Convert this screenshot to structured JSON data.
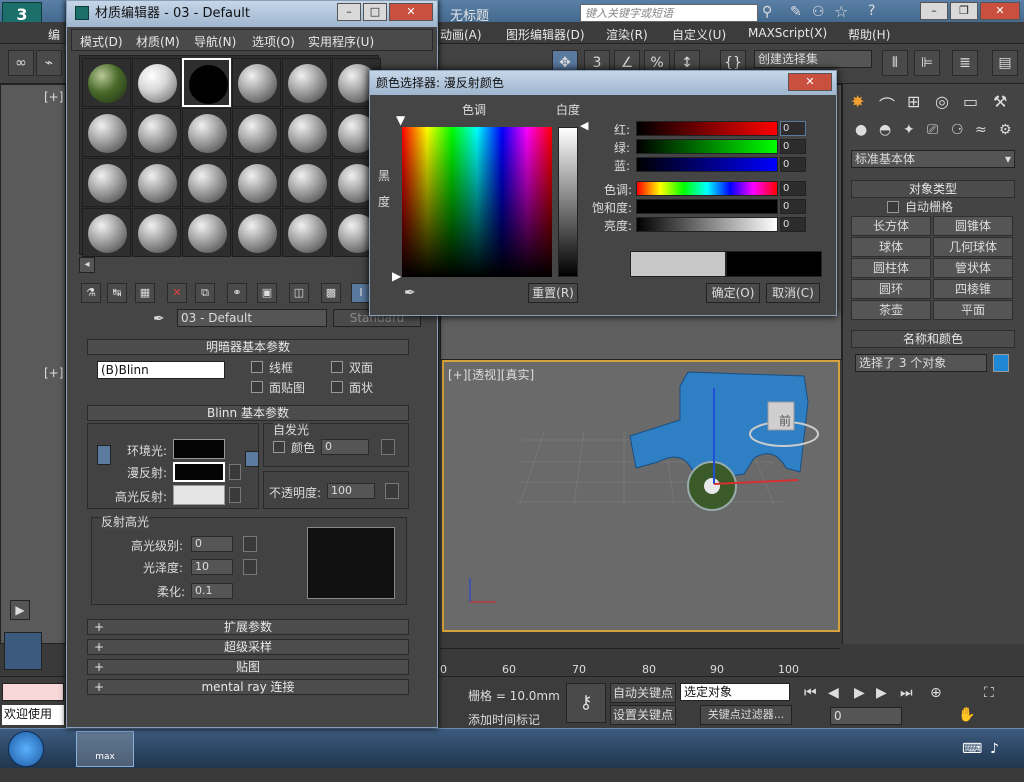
{
  "app": {
    "title": "无标题",
    "search_placeholder": "键入关键字或短语",
    "menu_items": [
      "编",
      "动画(A)",
      "图形编辑器(D)",
      "渲染(R)",
      "自定义(U)",
      "MAXScript(X)",
      "帮助(H)"
    ],
    "selection_set": "创建选择集",
    "viewport_labels": [
      "[+]",
      "[+]",
      "[+][透视][真实]"
    ],
    "cube_label": "前"
  },
  "command_panel": {
    "category": "标准基本体",
    "object_type_header": "对象类型",
    "auto_grid": "自动栅格",
    "buttons": [
      "长方体",
      "圆锥体",
      "球体",
      "几何球体",
      "圆柱体",
      "管状体",
      "圆环",
      "四棱锥",
      "茶壶",
      "平面"
    ],
    "name_color_header": "名称和颜色",
    "name_value": "选择了 3 个对象",
    "name_color": "#1e88d6"
  },
  "timeline": {
    "ticks": [
      "0",
      "60",
      "70",
      "80",
      "90",
      "100"
    ]
  },
  "bottom": {
    "grid": "栅格 = 10.0mm",
    "auto_key": "自动关键点",
    "set_key": "设置关键点",
    "selection_mode": "选定对象",
    "key_filter": "关键点过滤器...",
    "add_time_tag": "添加时间标记",
    "frame_value": "0",
    "welcome": "欢迎使用"
  },
  "material_editor": {
    "title": "材质编辑器 - 03 - Default",
    "menu": [
      "模式(D)",
      "材质(M)",
      "导航(N)",
      "选项(O)",
      "实用程序(U)"
    ],
    "material_name": "03 - Default",
    "material_type": "Standard",
    "shader_rollout": "明暗器基本参数",
    "shader": "(B)Blinn",
    "wire": "线框",
    "two_sided": "双面",
    "face_map": "面贴图",
    "faceted": "面状",
    "blinn_rollout": "Blinn 基本参数",
    "self_illum": "自发光",
    "color_label": "颜色",
    "self_illum_value": "0",
    "ambient": "环境光:",
    "diffuse": "漫反射:",
    "specular": "高光反射:",
    "opacity_label": "不透明度:",
    "opacity_value": "100",
    "spec_highlight": "反射高光",
    "spec_level": "高光级别:",
    "spec_level_value": "0",
    "glossiness": "光泽度:",
    "glossiness_value": "10",
    "soften": "柔化:",
    "soften_value": "0.1",
    "rollouts": [
      "扩展参数",
      "超级采样",
      "贴图",
      "mental ray 连接"
    ],
    "ambient_color": "#050505",
    "diffuse_color": "#050505",
    "specular_color": "#e5e5e5"
  },
  "color_picker": {
    "title": "颜色选择器: 漫反射颜色",
    "hue_label": "色调",
    "white_label": "白度",
    "black_label": "黑",
    "deg_label": "度",
    "red": "红:",
    "green": "绿:",
    "blue": "蓝:",
    "hue": "色调:",
    "sat": "饱和度:",
    "value": "亮度:",
    "red_val": "0",
    "green_val": "0",
    "blue_val": "0",
    "hue_val": "0",
    "sat_val": "0",
    "value_val": "0",
    "reset": "重置(R)",
    "ok": "确定(O)",
    "cancel": "取消(C)"
  },
  "taskbar": {
    "app_label": "max"
  }
}
